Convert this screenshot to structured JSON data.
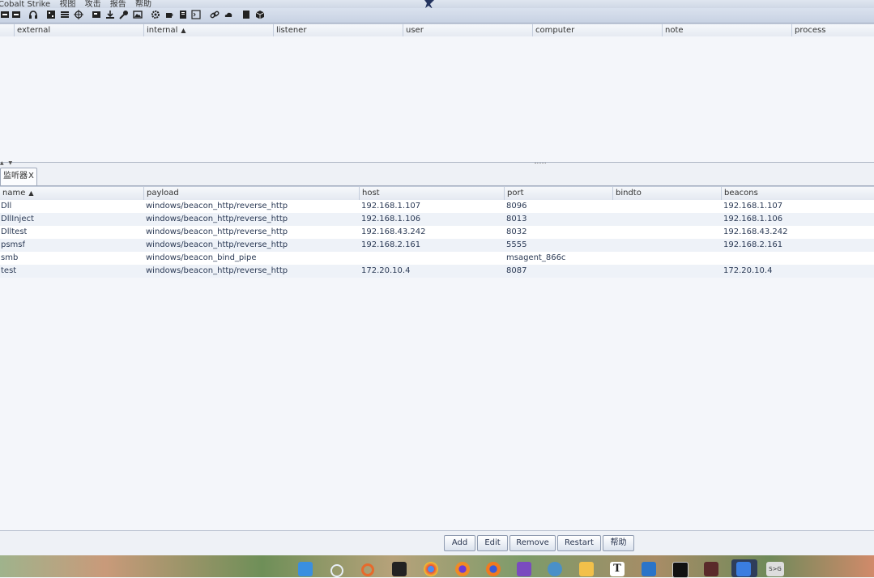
{
  "menubar": {
    "app_label": "Cobalt Strike",
    "items": [
      "视图",
      "攻击",
      "报告",
      "帮助"
    ]
  },
  "toolbar_icons": [
    "new-connection-icon",
    "disconnect-icon",
    "listeners-icon",
    "pivot-graph-icon",
    "session-table-icon",
    "targets-icon",
    "web-log-icon",
    "downloads-icon",
    "credentials-icon",
    "screenshots-icon",
    "settings-icon",
    "coffee-icon",
    "notes-icon",
    "console-icon",
    "link-icon",
    "cloud-icon",
    "book-icon",
    "package-icon"
  ],
  "sessions_table": {
    "columns": [
      "",
      "external",
      "internal",
      "listener",
      "user",
      "computer",
      "note",
      "process"
    ],
    "sorted_column": "internal"
  },
  "tabs": [
    {
      "label": "监听器",
      "close": "X"
    }
  ],
  "listeners_table": {
    "columns": [
      "name",
      "payload",
      "host",
      "port",
      "bindto",
      "beacons"
    ],
    "sorted_column": "name",
    "rows": [
      {
        "name": "Dll",
        "payload": "windows/beacon_http/reverse_http",
        "host": "192.168.1.107",
        "port": "8096",
        "bindto": "",
        "beacons": "192.168.1.107"
      },
      {
        "name": "DllInject",
        "payload": "windows/beacon_http/reverse_http",
        "host": "192.168.1.106",
        "port": "8013",
        "bindto": "",
        "beacons": "192.168.1.106"
      },
      {
        "name": "Dlltest",
        "payload": "windows/beacon_http/reverse_http",
        "host": "192.168.43.242",
        "port": "8032",
        "bindto": "",
        "beacons": "192.168.43.242"
      },
      {
        "name": "psmsf",
        "payload": "windows/beacon_http/reverse_http",
        "host": "192.168.2.161",
        "port": "5555",
        "bindto": "",
        "beacons": "192.168.2.161"
      },
      {
        "name": "smb",
        "payload": "windows/beacon_bind_pipe",
        "host": "",
        "port": "msagent_866c",
        "bindto": "",
        "beacons": ""
      },
      {
        "name": "test",
        "payload": "windows/beacon_http/reverse_http",
        "host": "172.20.10.4",
        "port": "8087",
        "bindto": "",
        "beacons": "172.20.10.4"
      }
    ]
  },
  "buttons": {
    "add": "Add",
    "edit": "Edit",
    "remove": "Remove",
    "restart": "Restart",
    "help": "帮助"
  },
  "taskbar": {
    "items": [
      "start-icon",
      "search-icon",
      "app-icon",
      "terminal-icon",
      "chrome-icon",
      "firefox-dev-icon",
      "firefox-icon",
      "visual-studio-icon",
      "app-icon",
      "folder-icon",
      "typora-icon",
      "remote-desktop-icon",
      "cmd-icon",
      "app-icon",
      "editor-icon",
      "app-icon"
    ],
    "text_icon_label": "T",
    "last_icon_label": "S>G"
  },
  "colors": {
    "row_text": "#2b3a55",
    "row_alt": "#eef2f8",
    "toolbar_bg": "#d3dbe8"
  }
}
